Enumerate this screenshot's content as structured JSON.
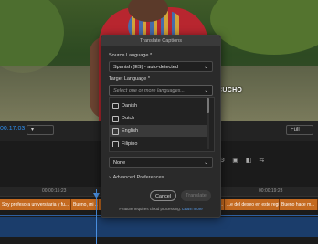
{
  "dialog": {
    "title": "Translate Captions",
    "source_label": "Source Language *",
    "source_value": "Spanish (ES) - auto-detected",
    "target_label": "Target Language *",
    "target_placeholder": "Select one or more languages...",
    "languages": [
      "Danish",
      "Dutch",
      "English",
      "Filipino"
    ],
    "hovered_language": "English",
    "speakers_value": "None",
    "advanced_label": "Advanced Preferences",
    "cancel_label": "Cancel",
    "translate_label": "Translate",
    "footnote": "Feature requires cloud processing.",
    "footnote_link": "Learn more"
  },
  "program_monitor": {
    "timecode": "00:17:03",
    "video_caption_text": "CUCHO",
    "fit_control": "Full"
  },
  "timeline": {
    "ruler_labels": [
      "00:00:15:23",
      "00:00:19:23"
    ],
    "caption_segments": [
      "Soy profesora universitaria y fu...",
      "Bueno, mi ...",
      "...",
      "...",
      "...e del deseo en este region",
      "Bueno hace m..."
    ]
  },
  "colors": {
    "caption_track": "#c46a20",
    "video_track": "#1b3d6b",
    "playhead": "#4a90e2",
    "link": "#5aa0f0"
  }
}
